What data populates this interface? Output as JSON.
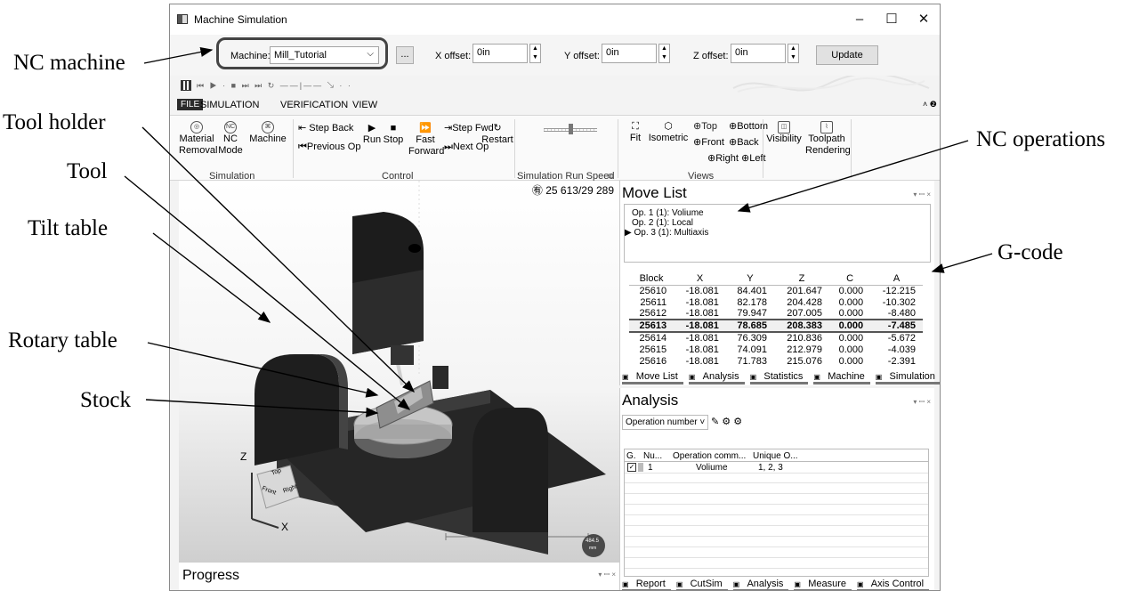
{
  "callouts": {
    "nc_machine": "NC machine",
    "tool_holder": "Tool holder",
    "tool": "Tool",
    "tilt_table": "Tilt table",
    "rotary_table": "Rotary table",
    "stock": "Stock",
    "nc_operations": "NC operations",
    "g_code": "G-code"
  },
  "window": {
    "title": "Machine Simulation",
    "minimize": "–",
    "maximize": "☐",
    "close": "✕"
  },
  "topbar": {
    "machine_label": "Machine:",
    "machine_value": "Mill_Tutorial",
    "browse": "...",
    "x_offset_label": "X offset:",
    "x_offset_value": "0in",
    "y_offset_label": "Y offset:",
    "y_offset_value": "0in",
    "z_offset_label": "Z offset:",
    "z_offset_value": "0in",
    "update": "Update"
  },
  "menu": [
    "FILE",
    "SIMULATION",
    "VERIFICATION",
    "VIEW"
  ],
  "ribbon": {
    "simulation": {
      "group": "Simulation",
      "material_removal": [
        "Material",
        "Removal"
      ],
      "nc_mode": [
        "NC",
        "Mode"
      ],
      "machine": "Machine"
    },
    "control": {
      "group": "Control",
      "step_back": "Step Back",
      "previous_op": "Previous Op",
      "run": "Run",
      "stop": "Stop",
      "fast_forward": [
        "Fast",
        "Forward"
      ],
      "step_fwd": "Step Fwd",
      "next_op": "Next Op",
      "restart": "Restart"
    },
    "speed": {
      "group": "Simulation Run Speed"
    },
    "views": {
      "group": "Views",
      "fit": "Fit",
      "isometric": "Isometric",
      "top": "Top",
      "bottom": "Bottom",
      "front": "Front",
      "back": "Back",
      "right": "Right",
      "left": "Left",
      "visibility": "Visibility",
      "toolpath_rendering": [
        "Toolpath",
        "Rendering"
      ]
    }
  },
  "viewport": {
    "counter": "25 613/29 289",
    "axis_z": "Z",
    "axis_x": "X",
    "cube_top": "Top",
    "cube_front": "Front",
    "cube_right": "Right",
    "scale_value": "484.5",
    "scale_unit": "mm"
  },
  "progress": {
    "title": "Progress"
  },
  "move_list": {
    "title": "Move List",
    "operations": [
      "Op. 1 (1): Voliume",
      "Op. 2 (1): Local",
      "Op. 3 (1): Multiaxis"
    ],
    "columns": [
      "Block",
      "X",
      "Y",
      "Z",
      "C",
      "A"
    ],
    "rows": [
      [
        "25610",
        "-18.081",
        "84.401",
        "201.647",
        "0.000",
        "-12.215"
      ],
      [
        "25611",
        "-18.081",
        "82.178",
        "204.428",
        "0.000",
        "-10.302"
      ],
      [
        "25612",
        "-18.081",
        "79.947",
        "207.005",
        "0.000",
        "-8.480"
      ],
      [
        "25613",
        "-18.081",
        "78.685",
        "208.383",
        "0.000",
        "-7.485"
      ],
      [
        "25614",
        "-18.081",
        "76.309",
        "210.836",
        "0.000",
        "-5.672"
      ],
      [
        "25615",
        "-18.081",
        "74.091",
        "212.979",
        "0.000",
        "-4.039"
      ],
      [
        "25616",
        "-18.081",
        "71.783",
        "215.076",
        "0.000",
        "-2.391"
      ]
    ],
    "selected_row": 3,
    "tabs": [
      "Move List",
      "Analysis",
      "Statistics",
      "Machine",
      "Simulation"
    ]
  },
  "analysis": {
    "title": "Analysis",
    "dropdown": "Operation number",
    "columns": [
      "G.",
      "Nu...",
      "Operation comm...",
      "Unique O..."
    ],
    "row": {
      "number": "1",
      "operation": "Voliume",
      "unique": "1, 2, 3"
    },
    "tabs": [
      "Report",
      "CutSim",
      "Analysis",
      "Measure",
      "Axis Control"
    ]
  },
  "colors": {
    "accent": "#2b2b2b",
    "selection_border": "#555555"
  }
}
